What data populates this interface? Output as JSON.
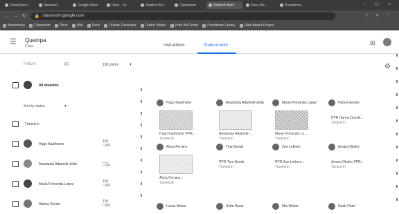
{
  "browser": {
    "tabs": [
      {
        "label": "Gmail Acco..."
      },
      {
        "label": "Rewanal..."
      },
      {
        "label": "Google Drive"
      },
      {
        "label": "Docs - Jo..."
      },
      {
        "label": "Student Ahi..."
      },
      {
        "label": "Classroom"
      },
      {
        "label": "Student Work"
      },
      {
        "label": "Docs Ma..."
      },
      {
        "label": "Presidents..."
      }
    ],
    "window_controls": "- ▢ ×",
    "url": "classroom.google.com",
    "extensions": "☆ ◐ ⋮",
    "bookmarks": [
      "Bookmarks",
      "Classroom",
      "Drive",
      "Mail",
      "Docs",
      "Outline Generator",
      "Rubric Maker",
      "Prior Art Finder",
      "Presidents Library",
      "Data Books Project"
    ]
  },
  "header": {
    "class_title": "Quempa",
    "class_subtitle": "Class",
    "tabs": [
      {
        "label": "Instructions",
        "active": false
      },
      {
        "label": "Student work",
        "active": true
      }
    ]
  },
  "toolbar": {
    "return_label": "Return",
    "points_label": "100 points"
  },
  "students_panel": {
    "all_students_label": "All students",
    "sort_label": "Sort by status",
    "sections": [
      {
        "label": "Turned in",
        "students": [
          {
            "name": "Hugo Kaufmann",
            "grade": "100\n/ 100"
          },
          {
            "name": "Anastasia Adamski-Jetta",
            "grade": "___\n/ 100"
          },
          {
            "name": "Maria Fernanda Lopez",
            "grade": "100\n/ 100"
          },
          {
            "name": "Hanna Gorski",
            "grade": "100\n/ 100"
          }
        ]
      }
    ]
  },
  "submissions": [
    {
      "name": "Hugo Kaufmann",
      "file": "Hugo Kaufmann PPR...",
      "status": "Turned in",
      "has_thumb": true,
      "thumb": "mid"
    },
    {
      "name": "Anastasia Adamski-Jetta",
      "file": "Anastasia Adamski-...",
      "status": "Turned in",
      "has_thumb": true,
      "thumb": "light"
    },
    {
      "name": "Maria Fernanda Lopez",
      "file": "Maria Fernanda Lo...",
      "status": "Turned in",
      "has_thumb": true,
      "thumb": "dark"
    },
    {
      "name": "Hanna Gorski",
      "file": "PPR Hanna Gorski...",
      "status": "Turned in",
      "has_thumb": false,
      "thumb": ""
    },
    {
      "name": "Alicia Ferrara",
      "file": "Alicia Ferrara...",
      "status": "Turned in",
      "has_thumb": true,
      "thumb": "light"
    },
    {
      "name": "Tina Novak",
      "file": "PPR Tina Novak",
      "status": "Turned in",
      "has_thumb": false,
      "thumb": ""
    },
    {
      "name": "Zoe Lefèvre",
      "file": "PPR Zoe Lefèvre...",
      "status": "Turned in",
      "has_thumb": false,
      "thumb": ""
    },
    {
      "name": "Amara Okafor",
      "file": "Amara Okafor PPR...",
      "status": "Turned in",
      "has_thumb": false,
      "thumb": ""
    },
    {
      "name": "Lucas Moore",
      "file": "",
      "status": "",
      "has_thumb": false,
      "thumb": ""
    },
    {
      "name": "Sofia Rossi",
      "file": "",
      "status": "",
      "has_thumb": false,
      "thumb": ""
    },
    {
      "name": "Mia Weber",
      "file": "",
      "status": "",
      "has_thumb": false,
      "thumb": ""
    },
    {
      "name": "Noah Patel",
      "file": "",
      "status": "",
      "has_thumb": false,
      "thumb": ""
    }
  ],
  "colors": {
    "accent": "#1a73e8",
    "chrome_dark": "#3a3a3a"
  }
}
